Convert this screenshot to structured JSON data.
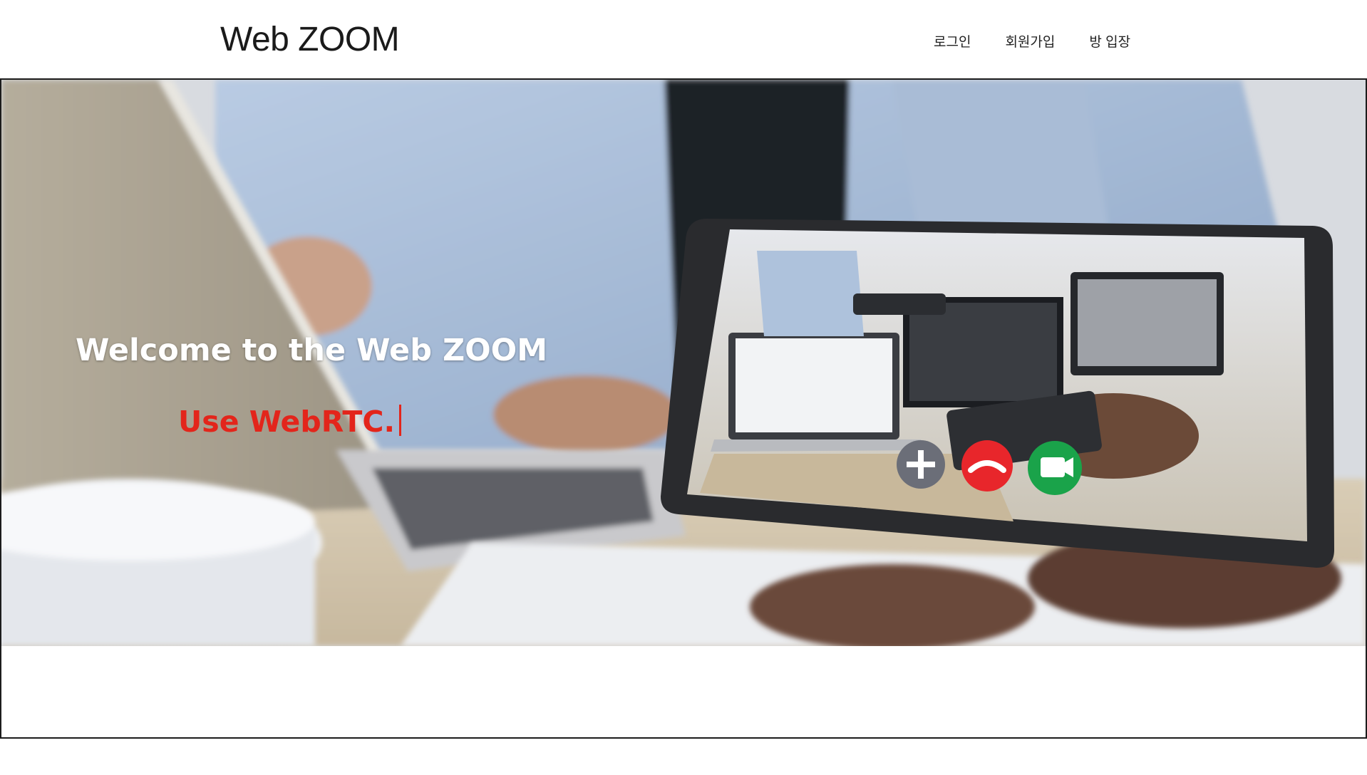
{
  "header": {
    "logo": "Web ZOOM",
    "nav": {
      "login": "로그인",
      "signup": "회원가입",
      "enter_room": "방 입장"
    }
  },
  "hero": {
    "title": "Welcome to the Web ZOOM",
    "subtitle": "Use WebRTC."
  },
  "colors": {
    "accent_red": "#e3251b",
    "call_add": "#6b6e78",
    "call_end": "#e8262b",
    "call_video": "#1aa34a"
  }
}
